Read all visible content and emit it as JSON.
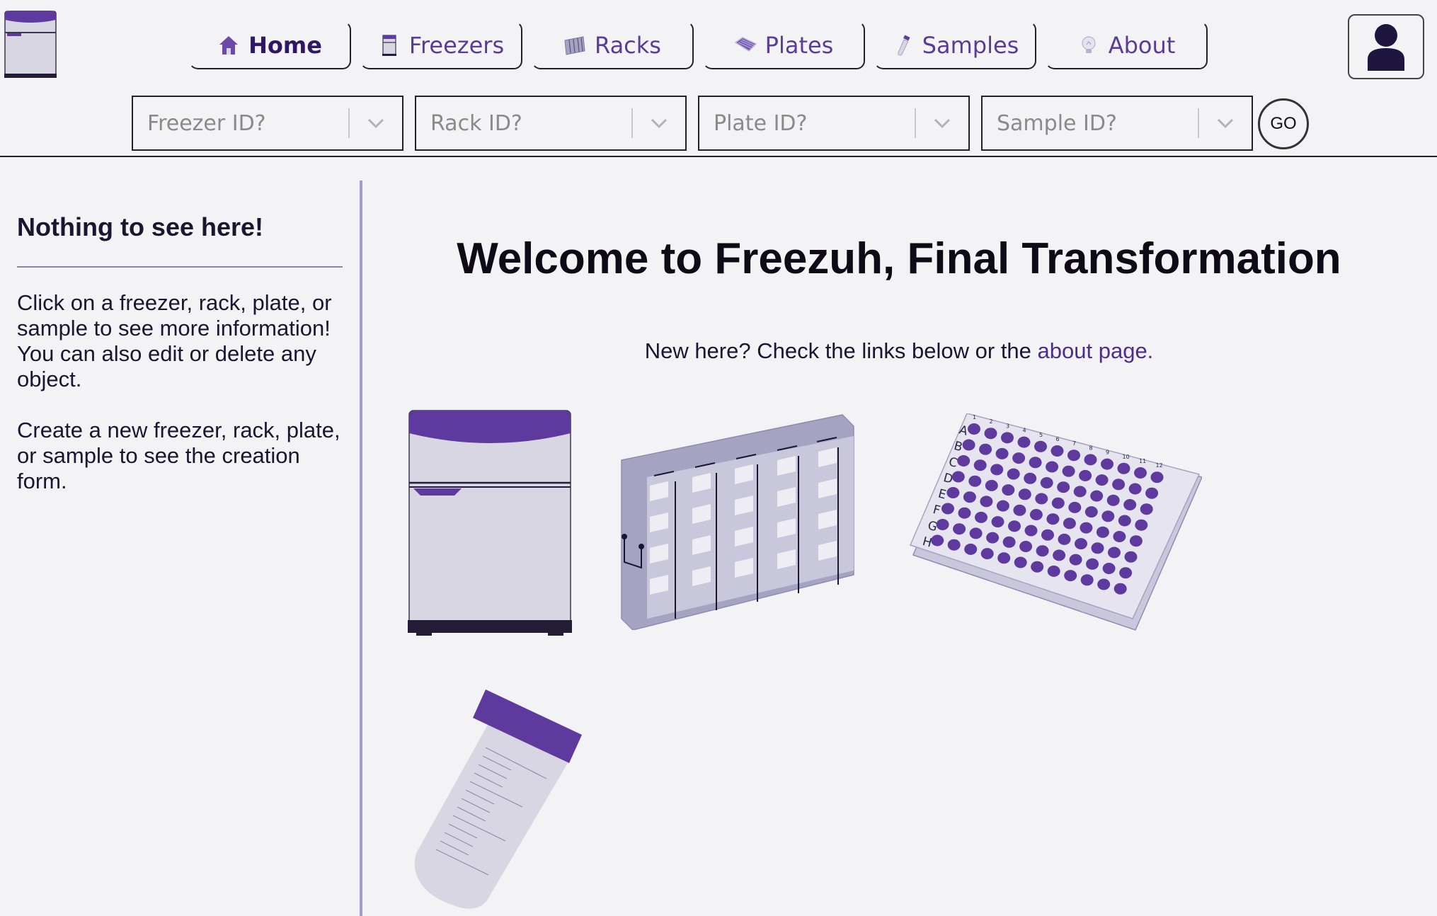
{
  "nav": [
    {
      "label": "Home",
      "icon": "house-icon",
      "active": true
    },
    {
      "label": "Freezers",
      "icon": "freezer-icon",
      "active": false
    },
    {
      "label": "Racks",
      "icon": "rack-icon",
      "active": false
    },
    {
      "label": "Plates",
      "icon": "plate-icon",
      "active": false
    },
    {
      "label": "Samples",
      "icon": "tube-icon",
      "active": false
    },
    {
      "label": "About",
      "icon": "lightbulb-icon",
      "active": false
    }
  ],
  "search": {
    "freezer_placeholder": "Freezer ID?",
    "rack_placeholder": "Rack ID?",
    "plate_placeholder": "Plate ID?",
    "sample_placeholder": "Sample ID?",
    "go_label": "GO"
  },
  "sidebar": {
    "title": "Nothing to see here!",
    "paragraph1": "Click on a freezer, rack, plate, or sample to see more information! You can also edit or delete any object.",
    "paragraph2": "Create a new freezer, rack, plate, or sample to see the creation form."
  },
  "main": {
    "title": "Welcome to Freezuh, Final Transformation",
    "intro_text": "New here? Check the links below or the ",
    "intro_link": "about page."
  },
  "plate": {
    "rows": [
      "A",
      "B",
      "C",
      "D",
      "E",
      "F",
      "G",
      "H"
    ],
    "columns": [
      "1",
      "2",
      "3",
      "4",
      "5",
      "6",
      "7",
      "8",
      "9",
      "10",
      "11",
      "12"
    ]
  },
  "colors": {
    "accent": "#5e3a9e",
    "body_grey": "#d8d6e2",
    "rack_grey": "#a5a3c2",
    "well_purple": "#5e3a9e",
    "dark": "#241c36"
  }
}
